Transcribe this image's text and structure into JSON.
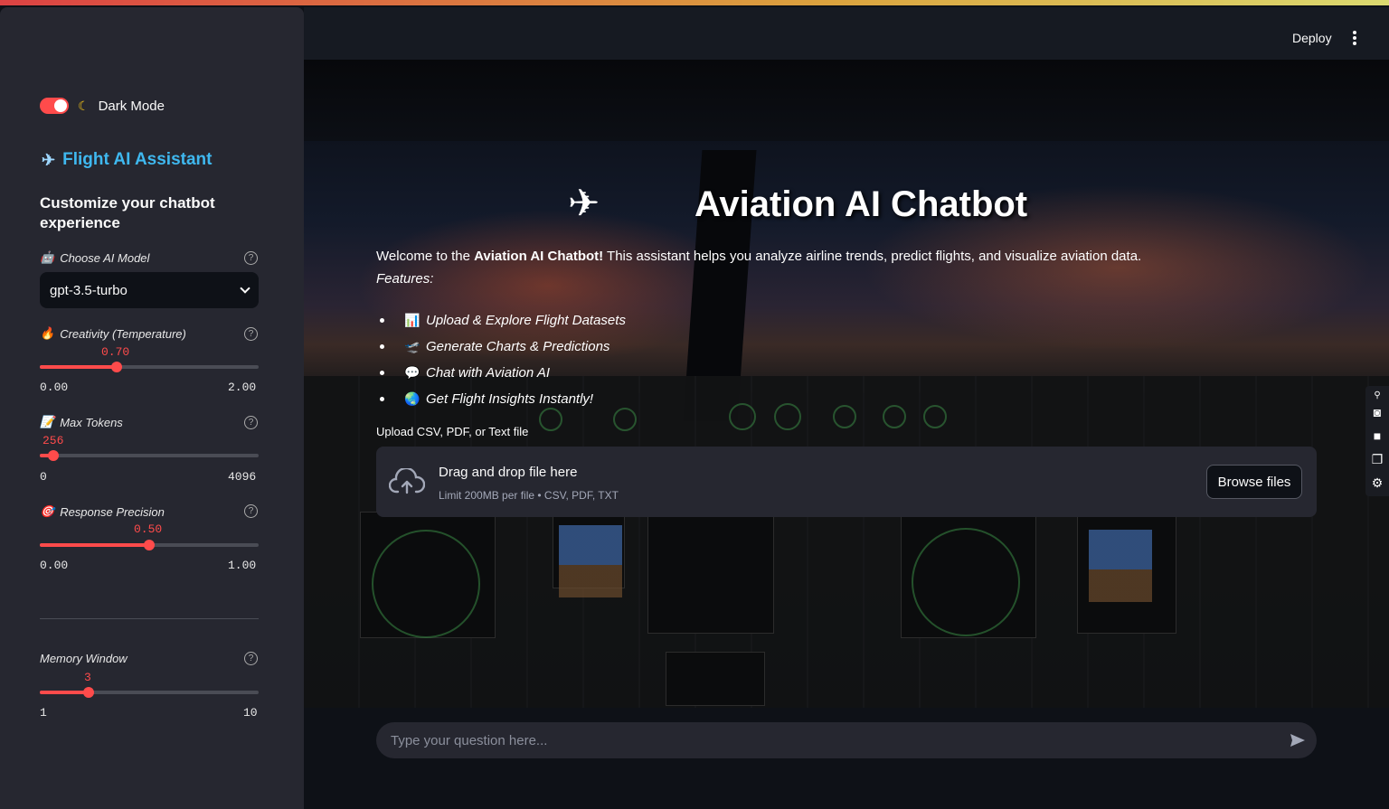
{
  "header": {
    "deploy_label": "Deploy"
  },
  "sidebar": {
    "dark_mode_label": "Dark Mode",
    "dark_mode_on": true,
    "brand_title": "Flight AI Assistant",
    "subtitle": "Customize your chatbot experience",
    "model": {
      "label": "Choose AI Model",
      "value": "gpt-3.5-turbo",
      "icon": "robot-icon"
    },
    "temperature": {
      "label": "Creativity (Temperature)",
      "value": "0.70",
      "min": "0.00",
      "max": "2.00",
      "fraction": 0.35,
      "icon": "fire-icon"
    },
    "max_tokens": {
      "label": "Max Tokens",
      "value": "256",
      "min": "0",
      "max": "4096",
      "fraction": 0.0625,
      "icon": "memo-icon"
    },
    "precision": {
      "label": "Response Precision",
      "value": "0.50",
      "min": "0.00",
      "max": "1.00",
      "fraction": 0.5,
      "icon": "target-icon"
    },
    "memory": {
      "label": "Memory Window",
      "value": "3",
      "min": "1",
      "max": "10",
      "fraction": 0.222
    }
  },
  "main": {
    "title": "Aviation AI Chatbot",
    "welcome_prefix": "Welcome to the ",
    "welcome_bold": "Aviation AI Chatbot!",
    "welcome_suffix": " This assistant helps you analyze airline trends, predict flights, and visualize aviation data.",
    "features_label": "Features:",
    "features": [
      {
        "icon": "chart-icon",
        "glyph": "📊",
        "text": "Upload & Explore Flight Datasets"
      },
      {
        "icon": "airplane-departure-icon",
        "glyph": "🛫",
        "text": "Generate Charts & Predictions"
      },
      {
        "icon": "speech-bubble-icon",
        "glyph": "💬",
        "text": "Chat with Aviation AI"
      },
      {
        "icon": "globe-icon",
        "glyph": "🌏",
        "text": "Get Flight Insights Instantly!"
      }
    ],
    "upload": {
      "label": "Upload CSV, PDF, or Text file",
      "drop_title": "Drag and drop file here",
      "drop_limit": "Limit 200MB per file • CSV, PDF, TXT",
      "browse_label": "Browse files"
    },
    "chat": {
      "placeholder": "Type your question here..."
    }
  },
  "colors": {
    "accent": "#ff4b4b",
    "brand": "#3fb8ef",
    "background": "#0e1117",
    "sidebar": "#262730"
  }
}
